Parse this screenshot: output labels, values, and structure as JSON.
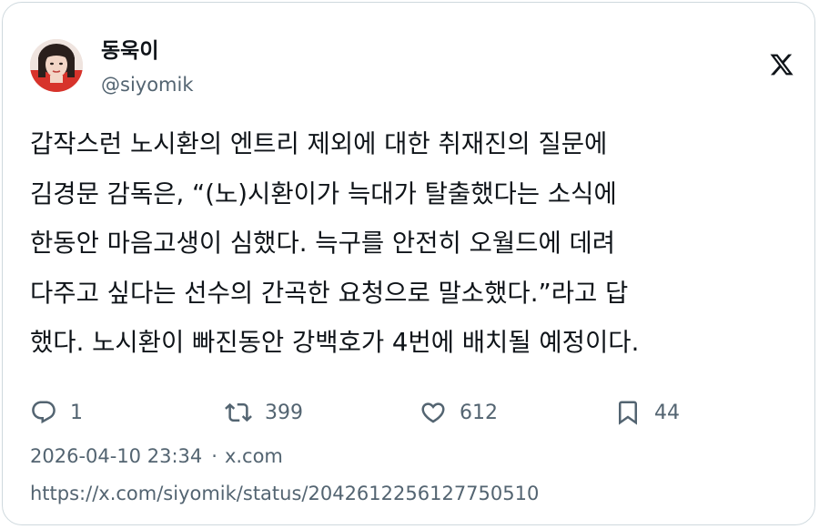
{
  "author": {
    "display_name": "동욱이",
    "handle": "@siyomik",
    "avatar_icon": "profile-photo"
  },
  "header": {
    "logo_icon": "x-logo-icon"
  },
  "tweet": {
    "lines": [
      "갑작스런 노시환의 엔트리 제외에 대한 취재진의 질문에",
      "김경문 감독은, “(노)시환이가 늑대가 탈출했다는 소식에",
      "한동안 마음고생이 심했다. 늑구를 안전히 오월드에 데려",
      "다주고 싶다는 선수의 간곡한 요청으로 말소했다.”라고 답",
      "했다. 노시환이 빠진동안 강백호가 4번에 배치될 예정이다."
    ]
  },
  "actions": {
    "reply": {
      "icon": "reply-icon",
      "count": "1"
    },
    "retweet": {
      "icon": "retweet-icon",
      "count": "399"
    },
    "like": {
      "icon": "heart-icon",
      "count": "612"
    },
    "bookmark": {
      "icon": "bookmark-icon",
      "count": "44"
    }
  },
  "meta": {
    "timestamp": "2026-04-10 23:34",
    "separator": "·",
    "source": "x.com"
  },
  "url": "https://x.com/siyomik/status/2042612256127750510",
  "colors": {
    "text": "#0f1419",
    "secondary": "#536471",
    "border": "#cfd9de",
    "accent": "#ff3b30"
  }
}
